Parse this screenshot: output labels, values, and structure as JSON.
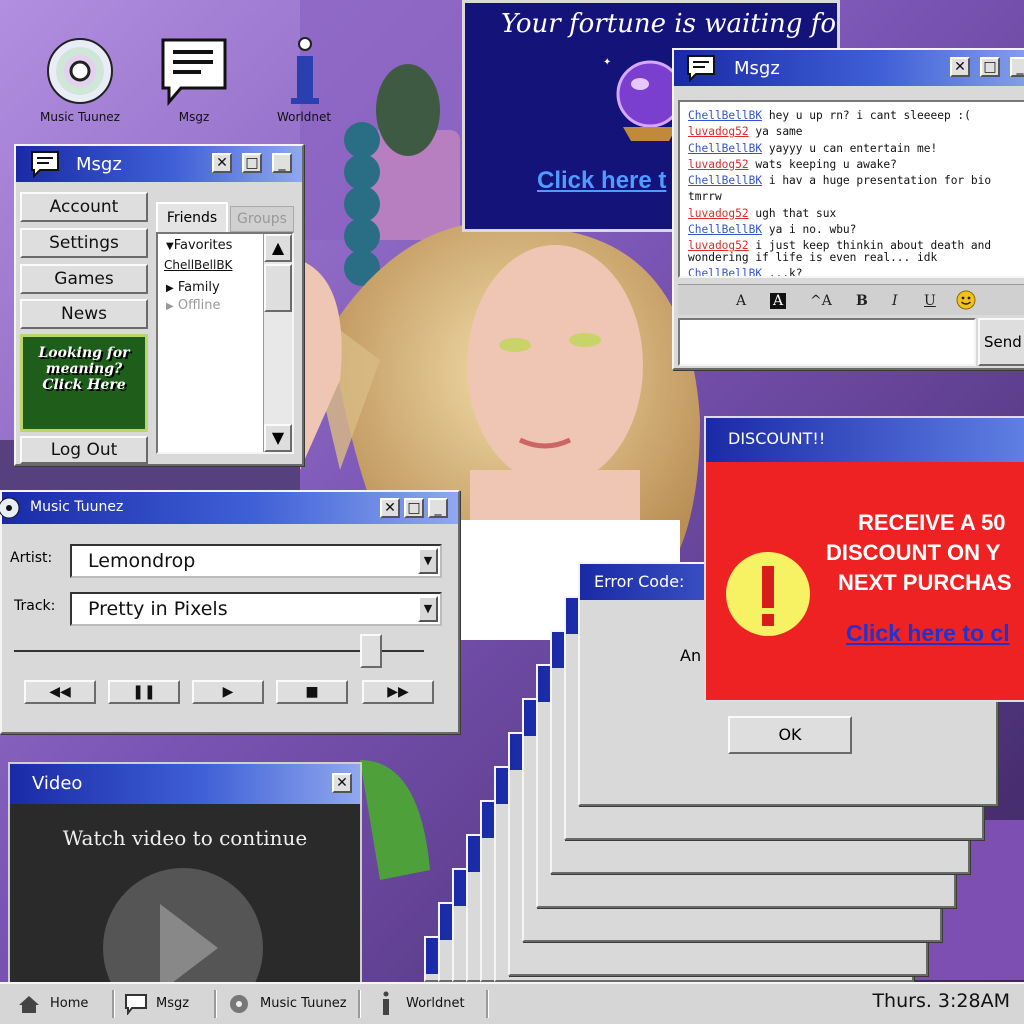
{
  "desktop_icons": [
    {
      "label": "Music Tuunez",
      "icon": "disc-icon"
    },
    {
      "label": "Msgz",
      "icon": "message-icon"
    },
    {
      "label": "Worldnet",
      "icon": "info-i-icon"
    }
  ],
  "msgz_side": {
    "title": "Msgz",
    "nav": [
      "Account",
      "Settings",
      "Games",
      "News"
    ],
    "ad_text": "Looking for meaning? Click Here",
    "logout": "Log Out",
    "tabs": [
      "Friends",
      "Groups"
    ],
    "favorites_label": "Favorites",
    "favorite_buddy": "ChellBellBK",
    "family_label": "Family",
    "offline_label": "Offline"
  },
  "fortune_ad": {
    "headline": "Your fortune is waiting for you",
    "cta": "Click here t"
  },
  "chat": {
    "title": "Msgz",
    "messages": [
      {
        "sn": "ChellBellBK",
        "text": "hey u up rn? i cant sleeeep :(",
        "color": "#3355cc"
      },
      {
        "sn": "luvadog52",
        "text": "ya same",
        "color": "#dd2a2a"
      },
      {
        "sn": "ChellBellBK",
        "text": "yayyy u can entertain me!",
        "color": "#3355cc"
      },
      {
        "sn": "luvadog52",
        "text": "wats keeping u awake?",
        "color": "#dd2a2a"
      },
      {
        "sn": "ChellBellBK",
        "text": "i hav a huge presentation for bio tmrrw",
        "color": "#3355cc"
      },
      {
        "sn": "luvadog52",
        "text": "ugh that sux",
        "color": "#dd2a2a"
      },
      {
        "sn": "ChellBellBK",
        "text": "ya i no. wbu?",
        "color": "#3355cc"
      },
      {
        "sn": "luvadog52",
        "text": "i just keep thinkin about death and wondering if life is even real... idk",
        "color": "#dd2a2a"
      },
      {
        "sn": "ChellBellBK",
        "text": "...k?",
        "color": "#3355cc"
      }
    ],
    "toolbar": [
      "A",
      "A",
      "^A",
      "B",
      "I",
      "U"
    ],
    "send_label": "Send"
  },
  "music": {
    "title": "Music Tuunez",
    "artist_label": "Artist:",
    "artist_value": "Lemondrop",
    "track_label": "Track:",
    "track_value": "Pretty in Pixels",
    "seek_position": 0.87
  },
  "video": {
    "title": "Video",
    "message": "Watch video to continue"
  },
  "error": {
    "title": "Error Code:",
    "text": "An",
    "ok_label": "OK"
  },
  "discount": {
    "title": "DISCOUNT!!",
    "text_lines": [
      "RECEIVE A 50",
      "DISCOUNT ON Y",
      "NEXT PURCHAS"
    ],
    "link": "Click here to cl"
  },
  "taskbar": {
    "items": [
      "Home",
      "Msgz",
      "Music Tuunez",
      "Worldnet"
    ],
    "clock": "Thurs. 3:28AM"
  },
  "colors": {
    "titlebar_start": "#1a2aa6",
    "titlebar_end": "#8fa8ee",
    "discount_red": "#ee2222",
    "link_blue": "#2233cc"
  }
}
